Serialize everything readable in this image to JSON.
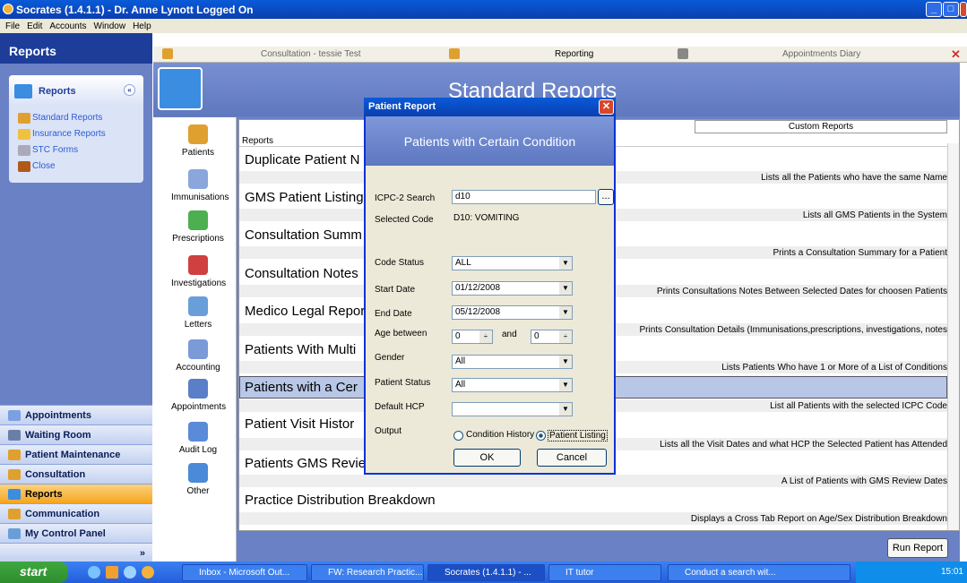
{
  "window": {
    "title": "Socrates (1.4.1.1) - Dr. Anne Lynott Logged On"
  },
  "menu": [
    "File",
    "Edit",
    "Accounts",
    "Window",
    "Help"
  ],
  "left": {
    "header": "Reports",
    "group_title": "Reports",
    "links": [
      "Standard Reports",
      "Insurance Reports",
      "STC Forms",
      "Close"
    ],
    "nav": [
      "Appointments",
      "Waiting Room",
      "Patient Maintenance",
      "Consultation",
      "Reports",
      "Communication",
      "My Control Panel"
    ]
  },
  "tabs": [
    "Consultation - tessie Test",
    "Reporting",
    "Appointments Diary"
  ],
  "banner": "Standard Reports",
  "icons": [
    "Patients",
    "Immunisations",
    "Prescriptions",
    "Investigations",
    "Letters",
    "Accounting",
    "Appointments",
    "Audit Log",
    "Other"
  ],
  "table": {
    "col": "Reports",
    "custom": "Custom Reports",
    "rows": [
      {
        "title": "Duplicate Patient N",
        "desc": "Lists all the Patients who have the same Name"
      },
      {
        "title": "GMS Patient Listing",
        "desc": "Lists all GMS Patients in the System"
      },
      {
        "title": "Consultation Summ",
        "desc": "Prints a Consultation Summary for a Patient"
      },
      {
        "title": "Consultation Notes",
        "desc": "Prints Consultations Notes Between Selected Dates for choosen Patients"
      },
      {
        "title": "Medico Legal Repor",
        "desc": "Prints Consultation Details (Immunisations,prescriptions, investigations, notes"
      },
      {
        "title": "Patients With Multi",
        "desc": "Lists Patients Who have 1 or More of a List of Conditions"
      },
      {
        "title": "Patients with a Cer",
        "desc": "List all Patients with the selected ICPC Code"
      },
      {
        "title": "Patient Visit Histor",
        "desc": "Lists all the Visit Dates and what HCP the Selected Patient has Attended"
      },
      {
        "title": "Patients GMS Revie",
        "desc": "A List of Patients with GMS Review Dates"
      },
      {
        "title": "Practice Distribution Breakdown",
        "desc": "Displays a Cross Tab Report on Age/Sex Distribution Breakdown"
      }
    ]
  },
  "run_report": "Run Report",
  "dialog": {
    "title": "Patient Report",
    "heading": "Patients with Certain Condition",
    "icpc_label": "ICPC-2 Search",
    "icpc_value": "d10",
    "browse": "...",
    "selected_label": "Selected Code",
    "selected_value": "D10: VOMITING",
    "code_status_label": "Code Status",
    "code_status": "ALL",
    "start_label": "Start Date",
    "start": "01/12/2008",
    "end_label": "End Date",
    "end": "05/12/2008",
    "age_label": "Age between",
    "age_from": "0",
    "and": "and",
    "age_to": "0",
    "gender_label": "Gender",
    "gender": "All",
    "pstatus_label": "Patient Status",
    "pstatus": "All",
    "hcp_label": "Default HCP",
    "hcp": "",
    "output_label": "Output",
    "opt1": "Condition History",
    "opt2": "Patient Listing",
    "ok": "OK",
    "cancel": "Cancel"
  },
  "taskbar": {
    "start": "start",
    "tasks": [
      "Inbox - Microsoft Out...",
      "FW: Research Practic...",
      "Socrates (1.4.1.1) - ...",
      "IT tutor",
      "Conduct a search wit..."
    ],
    "clock": "15:01"
  }
}
